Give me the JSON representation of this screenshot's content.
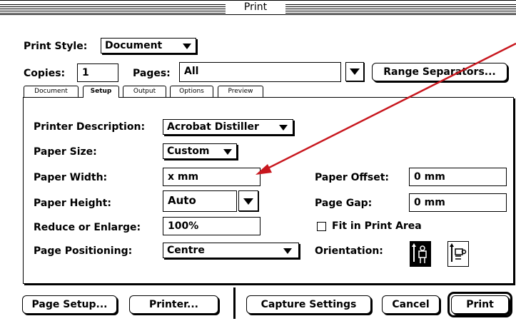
{
  "window": {
    "title": "Print"
  },
  "print_style": {
    "label": "Print Style:",
    "value": "Document"
  },
  "copies": {
    "label": "Copies:",
    "value": "1"
  },
  "pages": {
    "label": "Pages:",
    "value": "All"
  },
  "range_separators_button": "Range Separators...",
  "tabs": [
    {
      "label": "Document"
    },
    {
      "label": "Setup"
    },
    {
      "label": "Output"
    },
    {
      "label": "Options"
    },
    {
      "label": "Preview"
    }
  ],
  "active_tab": "Setup",
  "setup": {
    "printer_description": {
      "label": "Printer Description:",
      "value": "Acrobat Distiller"
    },
    "paper_size": {
      "label": "Paper Size:",
      "value": "Custom"
    },
    "paper_width": {
      "label": "Paper Width:",
      "value": "x  mm"
    },
    "paper_height": {
      "label": "Paper Height:",
      "value": "Auto"
    },
    "reduce_enlarge": {
      "label": "Reduce or Enlarge:",
      "value": "100%"
    },
    "page_positioning": {
      "label": "Page Positioning:",
      "value": "Centre"
    },
    "paper_offset": {
      "label": "Paper Offset:",
      "value": "0  mm"
    },
    "page_gap": {
      "label": "Page Gap:",
      "value": "0  mm"
    },
    "fit_in_print_area": {
      "label": "Fit in Print Area",
      "checked": false
    },
    "orientation": {
      "label": "Orientation:",
      "options": [
        "portrait",
        "landscape"
      ],
      "selected": "portrait"
    }
  },
  "buttons": {
    "page_setup": "Page Setup...",
    "printer": "Printer...",
    "capture_settings": "Capture Settings",
    "cancel": "Cancel",
    "print": "Print"
  },
  "annotation": {
    "color": "#c8171e"
  }
}
